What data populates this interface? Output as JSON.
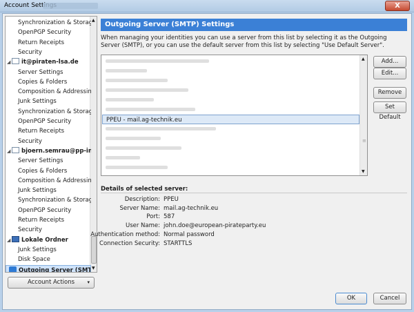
{
  "window": {
    "title": "Account Settings",
    "close_label": "X"
  },
  "tree": {
    "items": [
      {
        "label": "Synchronization & Storage",
        "kind": "sub"
      },
      {
        "label": "OpenPGP Security",
        "kind": "sub"
      },
      {
        "label": "Return Receipts",
        "kind": "sub"
      },
      {
        "label": "Security",
        "kind": "sub"
      },
      {
        "label": "it@piraten-lsa.de",
        "kind": "account"
      },
      {
        "label": "Server Settings",
        "kind": "sub"
      },
      {
        "label": "Copies & Folders",
        "kind": "sub"
      },
      {
        "label": "Composition & Addressing",
        "kind": "sub"
      },
      {
        "label": "Junk Settings",
        "kind": "sub"
      },
      {
        "label": "Synchronization & Storage",
        "kind": "sub"
      },
      {
        "label": "OpenPGP Security",
        "kind": "sub"
      },
      {
        "label": "Return Receipts",
        "kind": "sub"
      },
      {
        "label": "Security",
        "kind": "sub"
      },
      {
        "label": "bjoern.semrau@pp-inte...",
        "kind": "account"
      },
      {
        "label": "Server Settings",
        "kind": "sub"
      },
      {
        "label": "Copies & Folders",
        "kind": "sub"
      },
      {
        "label": "Composition & Addressing",
        "kind": "sub"
      },
      {
        "label": "Junk Settings",
        "kind": "sub"
      },
      {
        "label": "Synchronization & Storage",
        "kind": "sub"
      },
      {
        "label": "OpenPGP Security",
        "kind": "sub"
      },
      {
        "label": "Return Receipts",
        "kind": "sub"
      },
      {
        "label": "Security",
        "kind": "sub"
      },
      {
        "label": "Lokale Ordner",
        "kind": "account"
      },
      {
        "label": "Junk Settings",
        "kind": "sub"
      },
      {
        "label": "Disk Space",
        "kind": "sub"
      },
      {
        "label": "Outgoing Server (SMTP)",
        "kind": "selected"
      }
    ]
  },
  "account_actions_label": "Account Actions",
  "panel": {
    "title": "Outgoing Server (SMTP) Settings",
    "description": "When managing your identities you can use a server from this list by selecting it as the Outgoing Server (SMTP), or you can use the default server from this list by selecting \"Use Default Server\".",
    "servers": [
      {
        "label": "piratenbrandenburg - smtp.piraten-brandenburg",
        "blurred": true
      },
      {
        "label": "",
        "blurred": true
      },
      {
        "label": "",
        "blurred": true
      },
      {
        "label": "",
        "blurred": true
      },
      {
        "label": "",
        "blurred": true
      },
      {
        "label": "",
        "blurred": true
      },
      {
        "label": "PPEU - mail.ag-technik.eu",
        "blurred": false,
        "selected": true
      },
      {
        "label": "piraten-lsa - smtp.piraten-lsa",
        "blurred": true
      },
      {
        "label": "",
        "blurred": true
      },
      {
        "label": "",
        "blurred": true
      },
      {
        "label": "",
        "blurred": true
      },
      {
        "label": "",
        "blurred": true
      }
    ],
    "buttons": {
      "add": "Add...",
      "edit": "Edit...",
      "remove": "Remove",
      "set_default": "Set Default"
    },
    "details_title": "Details of selected server:",
    "details": [
      {
        "label": "Description:",
        "value": "PPEU"
      },
      {
        "label": "Server Name:",
        "value": "mail.ag-technik.eu"
      },
      {
        "label": "Port:",
        "value": "587"
      },
      {
        "label": "User Name:",
        "value": "john.doe@european-pirateparty.eu"
      },
      {
        "label": "Authentication method:",
        "value": "Normal password"
      },
      {
        "label": "Connection Security:",
        "value": "STARTTLS"
      }
    ]
  },
  "footer": {
    "ok": "OK",
    "cancel": "Cancel"
  }
}
